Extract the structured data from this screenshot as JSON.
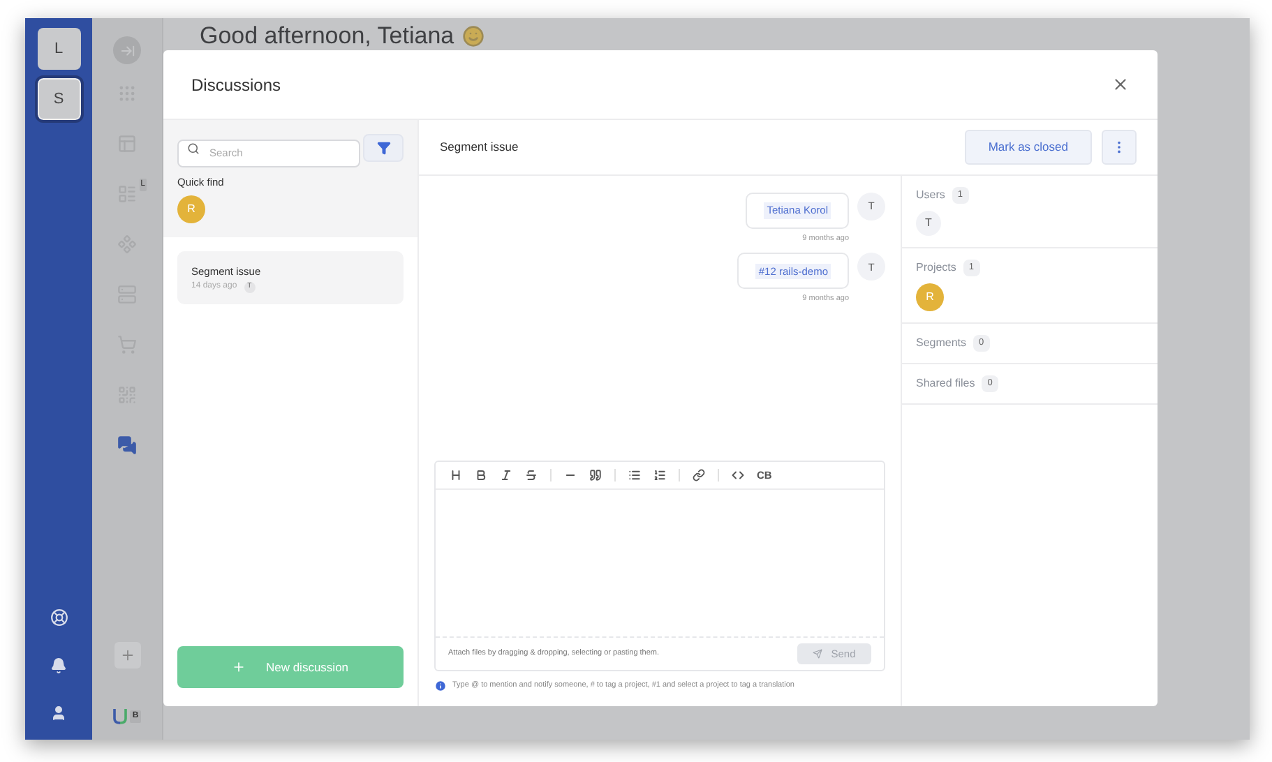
{
  "rail": {
    "workspaces": [
      {
        "label": "L",
        "selected": false
      },
      {
        "label": "S",
        "selected": true
      }
    ]
  },
  "sidebar": {
    "items": [
      {
        "kind": "collapse",
        "selected": false
      },
      {
        "kind": "grid",
        "selected": false
      },
      {
        "kind": "layout",
        "selected": false
      },
      {
        "kind": "list",
        "selected": false,
        "badge": "L"
      },
      {
        "kind": "components",
        "selected": false
      },
      {
        "kind": "storage",
        "selected": false
      },
      {
        "kind": "cart",
        "selected": false
      },
      {
        "kind": "qr",
        "selected": false
      },
      {
        "kind": "chat",
        "selected": true
      }
    ],
    "logo_badge": "B"
  },
  "greeting": "Good afternoon, Tetiana",
  "modal": {
    "title": "Discussions",
    "search": {
      "placeholder": "Search"
    },
    "quick_find": {
      "label": "Quick find",
      "avatars": [
        {
          "letter": "R",
          "kind": "project"
        }
      ]
    },
    "discussions": [
      {
        "title": "Segment issue",
        "time": "14 days ago",
        "avatar": "T",
        "selected": true
      }
    ],
    "new_button": "New discussion",
    "thread": {
      "title": "Segment issue",
      "close_button": "Mark as closed",
      "messages": [
        {
          "tag": "Tetiana Korol",
          "time": "9 months ago",
          "avatar": "T"
        },
        {
          "tag": "#12 rails-demo",
          "time": "9 months ago",
          "avatar": "T"
        }
      ],
      "toolbar": [
        {
          "kind": "heading"
        },
        {
          "kind": "bold"
        },
        {
          "kind": "italic"
        },
        {
          "kind": "strike"
        },
        {
          "kind": "divider"
        },
        {
          "kind": "rule"
        },
        {
          "kind": "quote"
        },
        {
          "kind": "divider"
        },
        {
          "kind": "bullets"
        },
        {
          "kind": "numbers"
        },
        {
          "kind": "divider"
        },
        {
          "kind": "link"
        },
        {
          "kind": "divider"
        },
        {
          "kind": "code"
        },
        {
          "kind": "label",
          "label": "CB"
        }
      ],
      "attach_hint": "Attach files by dragging & dropping, selecting or pasting them.",
      "send": {
        "label": "Send",
        "disabled": true
      },
      "info": "Type @ to mention and notify someone, # to tag a project, #1 and select a project to tag a translation"
    },
    "panel": [
      {
        "title": "Users",
        "count": "1",
        "avatars": [
          {
            "letter": "T",
            "kind": "user"
          }
        ]
      },
      {
        "title": "Projects",
        "count": "1",
        "avatars": [
          {
            "letter": "R",
            "kind": "project"
          }
        ]
      },
      {
        "title": "Segments",
        "count": "0"
      },
      {
        "title": "Shared files",
        "count": "0"
      }
    ]
  }
}
